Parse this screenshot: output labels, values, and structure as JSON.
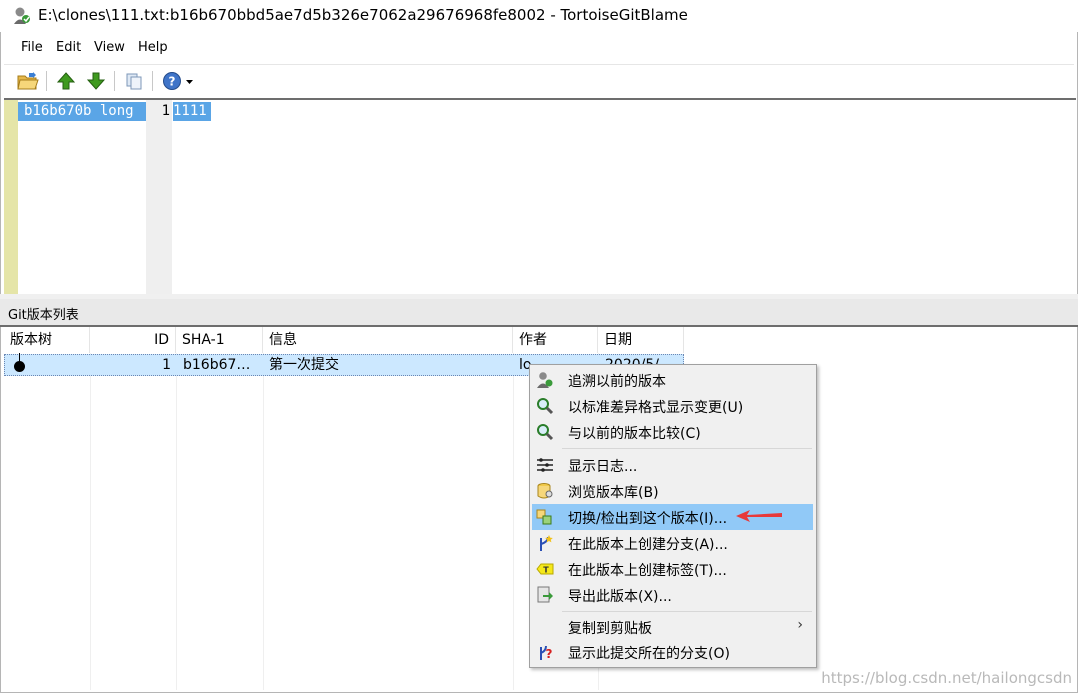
{
  "window": {
    "title": "E:\\clones\\111.txt:b16b670bbd5ae7d5b326e7062a29676968fe8002 - TortoiseGitBlame"
  },
  "menubar": {
    "items": [
      "File",
      "Edit",
      "View",
      "Help"
    ]
  },
  "toolbar": {
    "icons": [
      "open-folder-icon",
      "arrow-up-icon",
      "arrow-down-icon",
      "copy-icon",
      "help-icon",
      "dropdown-icon"
    ]
  },
  "blame": {
    "info": "b16b670b long",
    "line_number": "1",
    "code": "1111"
  },
  "panel": {
    "title": "Git版本列表"
  },
  "list": {
    "columns": [
      "版本树",
      "ID",
      "SHA-1",
      "信息",
      "作者",
      "日期"
    ],
    "rows": [
      {
        "id": "1",
        "sha": "b16b67…",
        "message": "第一次提交",
        "author": "lo",
        "date": "2020/5/..."
      }
    ]
  },
  "context_menu": {
    "items": [
      {
        "label": "追溯以前的版本",
        "icon": "blame-icon"
      },
      {
        "label": "以标准差异格式显示变更(U)",
        "icon": "magnifier-icon"
      },
      {
        "label": "与以前的版本比较(C)",
        "icon": "magnifier-icon"
      },
      {
        "label": "显示日志...",
        "icon": "log-icon"
      },
      {
        "label": "浏览版本库(B)",
        "icon": "repo-browser-icon"
      },
      {
        "label": "切换/检出到这个版本(I)...",
        "icon": "switch-icon",
        "highlighted": true
      },
      {
        "label": "在此版本上创建分支(A)...",
        "icon": "branch-icon"
      },
      {
        "label": "在此版本上创建标签(T)...",
        "icon": "tag-icon"
      },
      {
        "label": "导出此版本(X)...",
        "icon": "export-icon"
      },
      {
        "label": "复制到剪贴板",
        "icon": "",
        "submenu": true
      },
      {
        "label": "显示此提交所在的分支(O)",
        "icon": "branch-query-icon"
      }
    ]
  },
  "annotation": {
    "arrow_color": "#e8393a"
  },
  "watermark": "https://blog.csdn.net/hailongcsdn",
  "colors": {
    "selection": "#5aa5e6",
    "row_selection": "#cce8ff",
    "menu_highlight": "#91c9f7"
  }
}
